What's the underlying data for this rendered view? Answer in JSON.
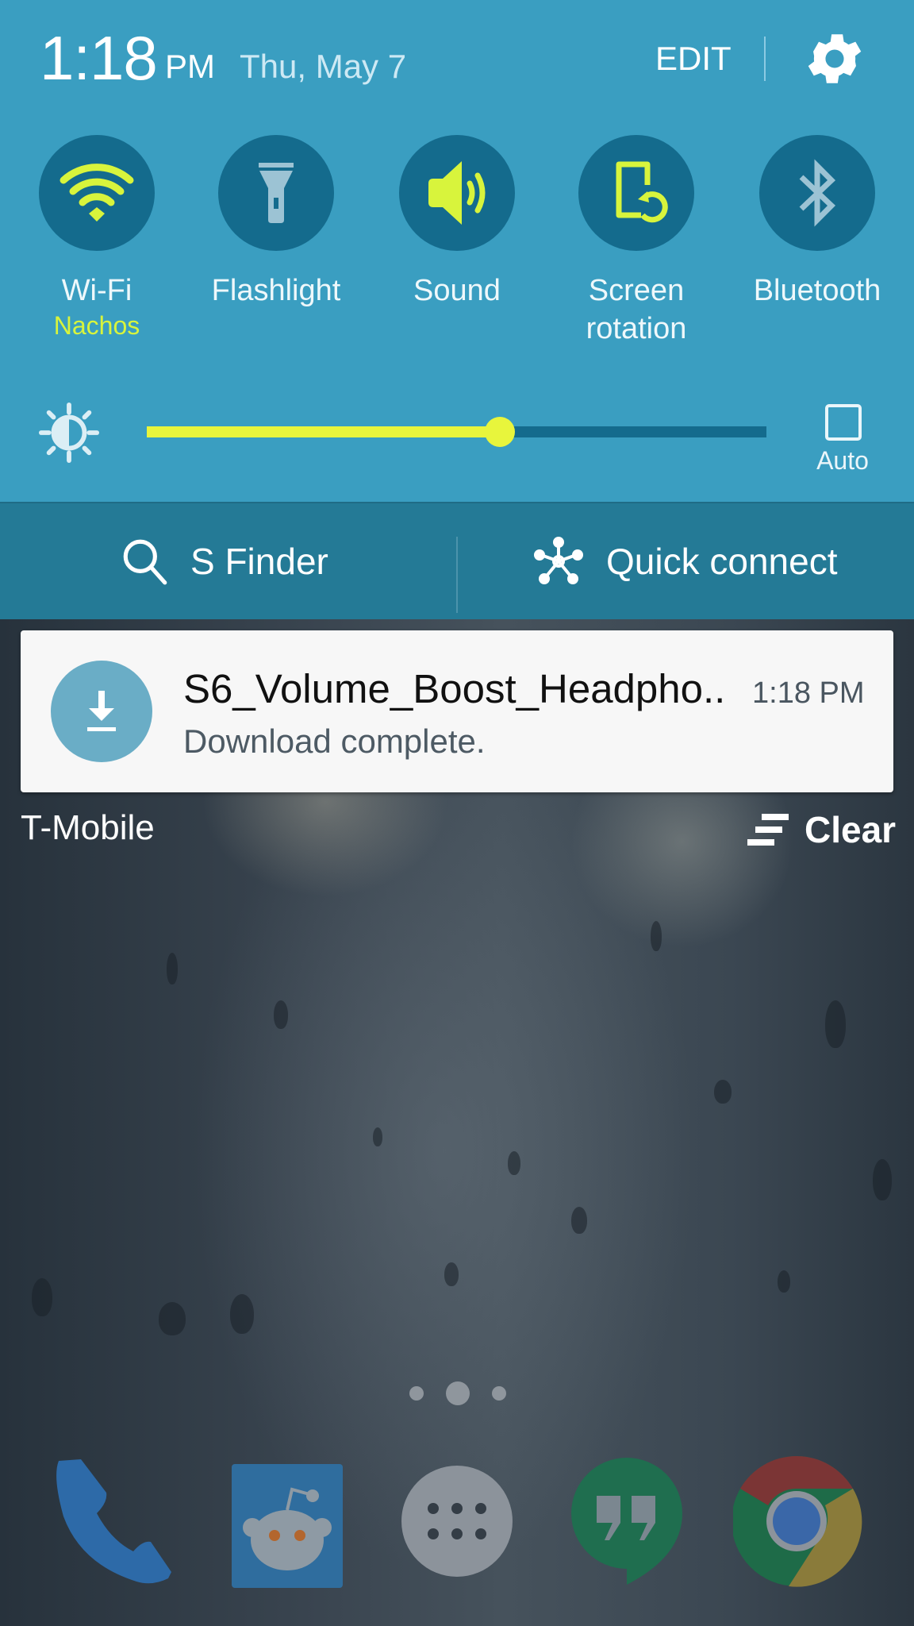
{
  "status": {
    "time": "1:18",
    "ampm": "PM",
    "date": "Thu, May 7"
  },
  "header": {
    "edit_label": "EDIT",
    "settings_icon": "gear-icon"
  },
  "quick_toggles": [
    {
      "id": "wifi",
      "label": "Wi-Fi",
      "sublabel": "Nachos",
      "icon": "wifi-icon",
      "state": "on"
    },
    {
      "id": "flashlight",
      "label": "Flashlight",
      "sublabel": "",
      "icon": "flashlight-icon",
      "state": "off"
    },
    {
      "id": "sound",
      "label": "Sound",
      "sublabel": "",
      "icon": "speaker-icon",
      "state": "on"
    },
    {
      "id": "rotation",
      "label": "Screen rotation",
      "label_line1": "Screen",
      "label_line2": "rotation",
      "sublabel": "",
      "icon": "screen-rotation-icon",
      "state": "on"
    },
    {
      "id": "bluetooth",
      "label": "Bluetooth",
      "sublabel": "",
      "icon": "bluetooth-icon",
      "state": "off"
    }
  ],
  "brightness": {
    "level": 0.57,
    "auto_label": "Auto",
    "auto_checked": false
  },
  "strip": {
    "sfinder_label": "S Finder",
    "quickconnect_label": "Quick connect"
  },
  "notification": {
    "title": "S6_Volume_Boost_Headpho..",
    "time": "1:18 PM",
    "body": "Download complete.",
    "icon": "download-icon"
  },
  "footer": {
    "carrier": "T-Mobile",
    "clear_label": "Clear"
  },
  "home": {
    "pages": 3,
    "current_page": 2,
    "dock": [
      {
        "name": "Phone",
        "icon": "phone-icon"
      },
      {
        "name": "Reddit",
        "icon": "reddit-icon"
      },
      {
        "name": "Apps",
        "icon": "apps-icon"
      },
      {
        "name": "Hangouts",
        "icon": "hangouts-icon"
      },
      {
        "name": "Chrome",
        "icon": "chrome-icon"
      }
    ]
  },
  "colors": {
    "panel_bg": "#3a9ec1",
    "toggle_bg": "#146b8d",
    "accent_on": "#d8f43c",
    "strip_bg": "#247a96"
  }
}
